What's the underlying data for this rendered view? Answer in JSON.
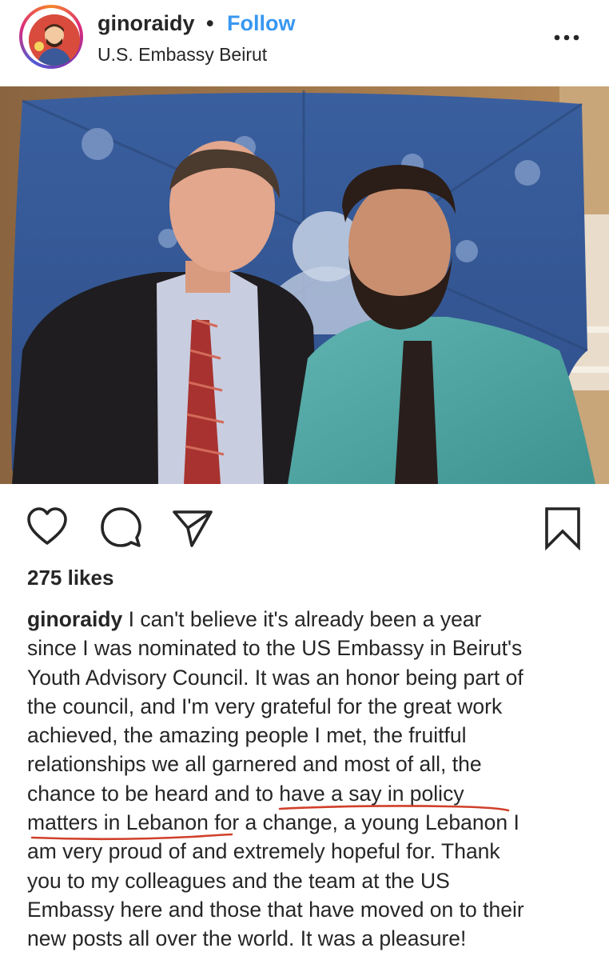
{
  "post": {
    "username": "ginoraidy",
    "separator": "•",
    "follow_label": "Follow",
    "location": "U.S. Embassy Beirut",
    "likes": "275 likes",
    "caption_username": "ginoraidy",
    "caption_lines": [
      " I can't believe it's already been a year",
      "since I was nominated to the US Embassy in Beirut's",
      "Youth Advisory Council. It was an honor being part of",
      "the council, and I'm very grateful for the great work",
      "achieved, the amazing people I met, the fruitful",
      "relationships we all garnered and most of all, the",
      "chance to be heard and to have a say in policy",
      "matters in Lebanon for a change, a young Lebanon I",
      "am very proud of and extremely hopeful for. Thank",
      "you to my colleagues and the team at the US",
      "Embassy here and those that have moved on to their",
      "new posts all over the world. It was a pleasure!"
    ]
  },
  "icons": {
    "more": "more-options-icon",
    "like": "heart-icon",
    "comment": "comment-bubble-icon",
    "share": "paper-plane-icon",
    "save": "bookmark-icon"
  },
  "colors": {
    "follow": "#3897f0",
    "text": "#262626",
    "underline": "#d0402a"
  }
}
